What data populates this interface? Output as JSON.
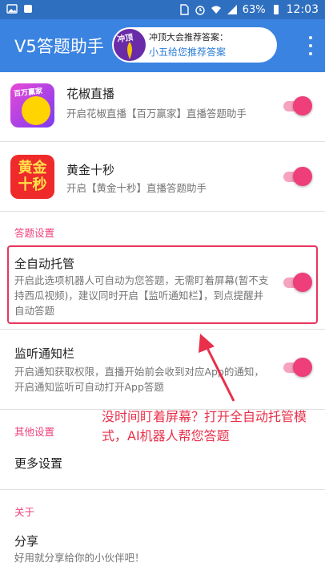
{
  "status_bar": {
    "battery": "63%",
    "time": "12:03"
  },
  "app_bar": {
    "title": "V5答题助手",
    "recommend_line1": "冲顶大会推荐答案：",
    "recommend_line2": "小五给您推荐答案",
    "logo_text": "冲顶"
  },
  "apps": [
    {
      "title": "花椒直播",
      "desc": "开启花椒直播【百万赢家】直播答题助手",
      "icon_label": "百万赢家",
      "toggle": true
    },
    {
      "title": "黄金十秒",
      "desc": "开启【黄金十秒】直播答题助手",
      "icon_label_1": "黄金",
      "icon_label_2": "十秒",
      "toggle": true
    }
  ],
  "sections": {
    "answer_settings": "答题设置",
    "other_settings": "其他设置",
    "about": "关于"
  },
  "auto_host": {
    "title": "全自动托管",
    "desc": "开启此选项机器人可自动为您答题，无需盯着屏幕(暂不支持西瓜视频)，建议同时开启【监听通知栏】，到点提醒并自动答题",
    "toggle": true
  },
  "listen_notification": {
    "title": "监听通知栏",
    "desc": "开启通知获取权限，直播开始前会收到对应App的通知，开启通知监听可自动打开App答题",
    "toggle": true
  },
  "more_settings": {
    "title": "更多设置"
  },
  "share": {
    "title": "分享",
    "desc": "好用就分享给你的小伙伴吧！"
  },
  "annotation": {
    "callout": "没时间盯着屏幕？打开全自动托管模式，AI机器人帮您答题"
  },
  "colors": {
    "status_bar": "#2f6fbf",
    "app_bar": "#3a83e0",
    "accent": "#ee3f7a",
    "annotation": "#e8304a"
  }
}
